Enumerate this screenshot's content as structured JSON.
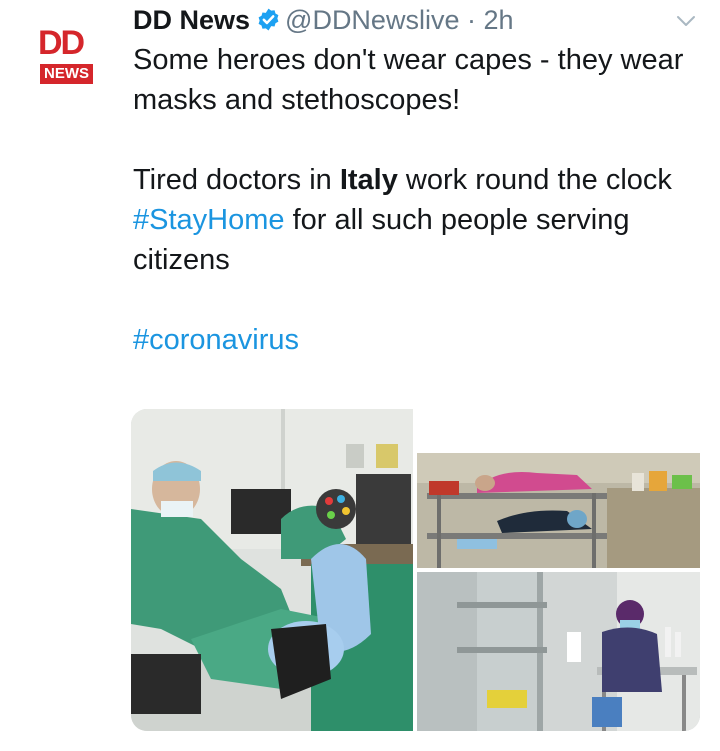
{
  "tweet": {
    "avatar": {
      "line1": "DD",
      "line2": "NEWS"
    },
    "author_name": "DD News",
    "verified_icon": "verified-badge-icon",
    "handle": "@DDNewslive",
    "separator": "·",
    "time": "2h",
    "menu_icon": "chevron-down-icon",
    "text": {
      "line1": "Some heroes don't wear capes - they wear masks and stethoscopes!",
      "line2_pre": "Tired doctors in ",
      "line2_bold": "Italy",
      "line2_post": " work round the clock",
      "line3_hashtag": "#StayHome",
      "line3_post": " for all such people serving citizens",
      "line4_hashtag": "#coronavirus"
    },
    "colors": {
      "link": "#1b95e0",
      "secondary": "#657786",
      "brand_red": "#d5262b",
      "verified": "#1da1f2"
    }
  }
}
